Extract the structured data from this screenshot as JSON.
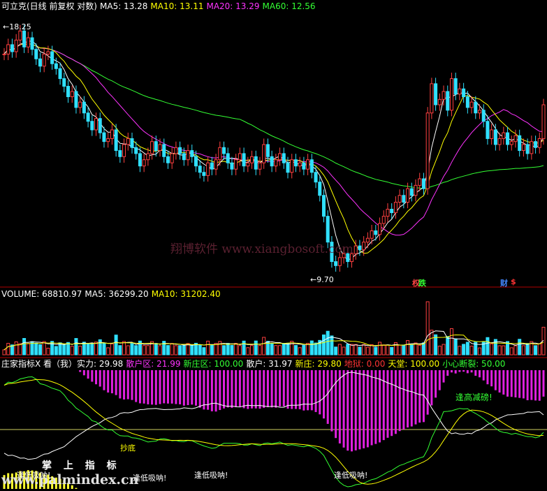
{
  "price_panel": {
    "legend": [
      {
        "label": "可立克(日线 前复权 对数)",
        "color": "#ffffff"
      },
      {
        "label": "MA5: 13.28",
        "color": "#ffffff"
      },
      {
        "label": "MA10: 13.11",
        "color": "#ffff00"
      },
      {
        "label": "MA20: 13.29",
        "color": "#ff33ff"
      },
      {
        "label": "MA60: 12.56",
        "color": "#33ff33"
      }
    ],
    "high_marker": "18.25",
    "low_marker": "9.70",
    "watermark": "翔博软件 www.xiangbosoft.com",
    "event_marks": [
      {
        "text": "权",
        "color": "#ff4444"
      },
      {
        "text": "跌",
        "color": "#33ff33"
      },
      {
        "text": "财",
        "color": "#4488ff"
      },
      {
        "text": "$",
        "color": "#ff3333"
      }
    ]
  },
  "volume_panel": {
    "legend": [
      {
        "label": "VOLUME: 68810.97",
        "color": "#ffffff"
      },
      {
        "label": "MA5: 36299.20",
        "color": "#ffffff"
      },
      {
        "label": "MA10: 31202.40",
        "color": "#ffff00"
      }
    ]
  },
  "indicator_panel": {
    "legend": [
      {
        "label": "庄家指标X 看（我）实力: 29.98",
        "color": "#ffffff"
      },
      {
        "label": "散户区: 21.99",
        "color": "#ff33ff"
      },
      {
        "label": "新庄区: 100.00",
        "color": "#33ff33"
      },
      {
        "label": "散户: 31.97",
        "color": "#ffffff"
      },
      {
        "label": "新庄: 29.80",
        "color": "#ffff00"
      },
      {
        "label": "地狱: 0.00",
        "color": "#ff3333"
      },
      {
        "label": "天堂: 100.00",
        "color": "#ffff00"
      },
      {
        "label": "小心断裂: 50.00",
        "color": "#33ff33"
      }
    ],
    "annotations": [
      {
        "text": "逢高减磅!",
        "color": "#33ff33"
      },
      {
        "text": "抄底",
        "color": "#ffff00"
      },
      {
        "text": "逢低吸呐!",
        "color": "#ffffff"
      },
      {
        "text": "逢低吸呐!",
        "color": "#ffffff"
      },
      {
        "text": "逢低吸呐!",
        "color": "#ffffff"
      },
      {
        "text": "逢低吸呐!",
        "color": "#ffffff"
      }
    ],
    "watermark_title": "掌 上 指 标",
    "watermark_url": "www.palmindex.cn"
  },
  "chart_data": {
    "type": "candlestick",
    "close": [
      16.8,
      17.2,
      16.9,
      17.4,
      17.8,
      17.1,
      17.5,
      17.0,
      16.6,
      16.3,
      16.8,
      16.9,
      16.4,
      16.2,
      15.8,
      15.5,
      15.1,
      15.3,
      14.7,
      14.9,
      14.5,
      14.2,
      13.9,
      14.3,
      13.8,
      13.5,
      13.6,
      13.9,
      13.2,
      13.0,
      13.4,
      13.6,
      13.3,
      13.1,
      12.7,
      12.9,
      13.1,
      13.5,
      13.2,
      13.4,
      13.0,
      12.8,
      13.1,
      13.3,
      13.1,
      12.9,
      13.2,
      13.0,
      12.7,
      12.5,
      12.4,
      12.8,
      12.6,
      12.9,
      13.3,
      13.1,
      12.8,
      12.6,
      12.9,
      13.1,
      12.7,
      12.8,
      13.0,
      12.6,
      12.8,
      13.4,
      13.0,
      12.7,
      12.9,
      13.1,
      12.8,
      12.5,
      12.9,
      12.7,
      12.8,
      12.6,
      12.9,
      12.5,
      12.2,
      11.8,
      11.2,
      10.5,
      10.0,
      9.9,
      10.1,
      10.2,
      10.0,
      10.2,
      10.4,
      10.3,
      10.5,
      10.6,
      10.8,
      10.7,
      11.0,
      11.2,
      11.4,
      11.3,
      11.6,
      11.8,
      11.6,
      12.0,
      11.8,
      12.1,
      12.3,
      12.0,
      14.5,
      15.6,
      14.8,
      15.0,
      15.3,
      14.6,
      15.8,
      15.2,
      15.4,
      15.1,
      14.7,
      14.9,
      14.5,
      14.6,
      14.2,
      13.6,
      13.9,
      13.4,
      13.6,
      13.8,
      13.4,
      13.5,
      13.7,
      13.2,
      13.4,
      13.1,
      13.5,
      13.3,
      13.6,
      14.8
    ],
    "ma_values": {
      "MA5": 13.28,
      "MA10": 13.11,
      "MA20": 13.29,
      "MA60": 12.56
    },
    "price_high": 18.25,
    "price_low": 9.7,
    "volume": {
      "VOLUME": 68810.97,
      "MA5": 36299.2,
      "MA10": 31202.4
    },
    "indicator": {
      "实力": 29.98,
      "散户区": 21.99,
      "新庄区": 100.0,
      "散户": 31.97,
      "新庄": 29.8,
      "地狱": 0.0,
      "天堂": 100.0,
      "小心断裂": 50.0
    }
  }
}
